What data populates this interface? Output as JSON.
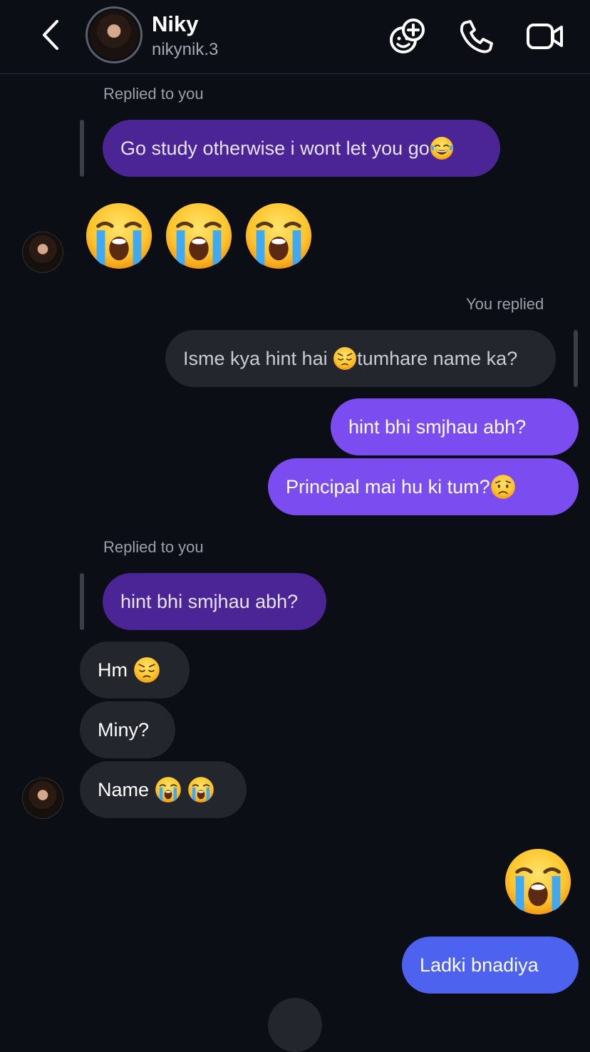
{
  "header": {
    "name": "Niky",
    "username": "nikynik.3"
  },
  "messages": {
    "reply1_meta": "Replied to you",
    "reply1_quote": "Go study otherwise i wont let you go",
    "reply2_meta": "You replied",
    "reply2_quote_a": "Isme kya hint hai ",
    "reply2_quote_b": "tumhare name ka?",
    "sent1": "hint bhi smjhau abh?",
    "sent2": "Principal mai hu ki tum?",
    "reply3_meta": "Replied to you",
    "reply3_quote": "hint bhi smjhau abh?",
    "recv1": "Hm ",
    "recv2": "Miny?",
    "recv3": "Name ",
    "sent3": "Ladki bnadiya"
  },
  "colors": {
    "background": "#0b0e14",
    "sent_purple": "#7b4cf0",
    "sent_blue": "#4d62ee",
    "received": "#23262d",
    "quoted_purple": "#4b2596"
  }
}
